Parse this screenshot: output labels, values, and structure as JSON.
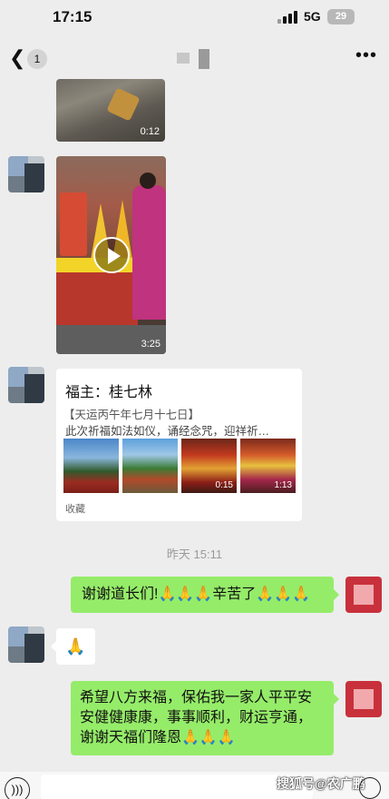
{
  "status_bar": {
    "time": "17:15",
    "network": "5G",
    "battery": "29"
  },
  "nav": {
    "back_count": "1"
  },
  "videos": [
    {
      "duration": "0:12"
    },
    {
      "duration": "3:25"
    }
  ],
  "card": {
    "title": "福主：桂七林",
    "date": "【天运丙午年七月十七日】",
    "description": "此次祈福如法如仪，诵经念咒，迎祥祈…",
    "thumbs": [
      {
        "duration": ""
      },
      {
        "duration": ""
      },
      {
        "duration": "0:15"
      },
      {
        "duration": "1:13"
      }
    ],
    "source": "收藏"
  },
  "timestamp": "昨天 15:11",
  "messages": {
    "thanks": "谢谢道长们!🙏🙏🙏辛苦了🙏🙏🙏",
    "reply_emoji": "🙏",
    "wish": "希望八方来福，保佑我一家人平平安安健健康康，事事顺利，财运亨通，谢谢天福们隆恩🙏🙏🙏"
  },
  "watermark": "搜狐号@农广鹏"
}
